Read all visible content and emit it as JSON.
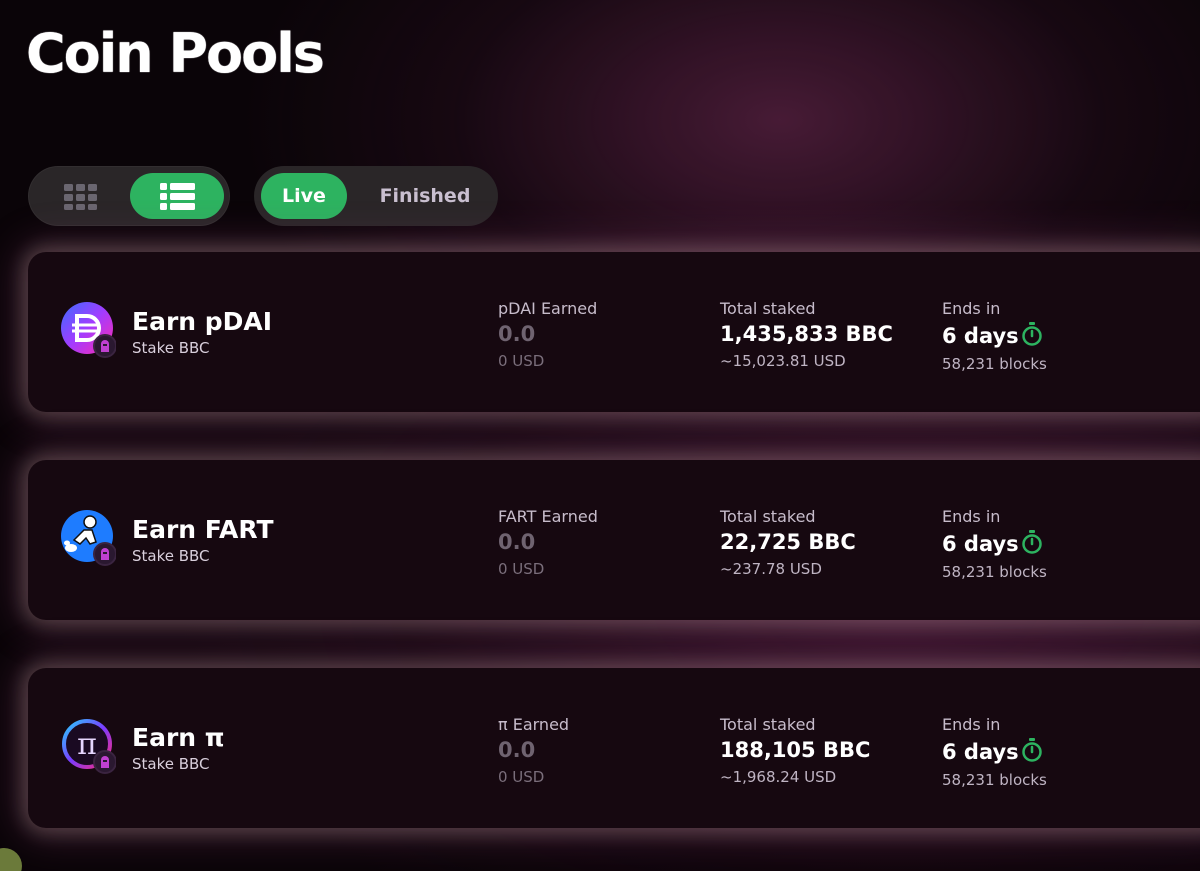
{
  "page": {
    "title": "Coin Pools"
  },
  "controls": {
    "view_icons": [
      "grid-view-icon",
      "list-view-icon"
    ],
    "active_view": "list",
    "status_tabs": [
      "Live",
      "Finished"
    ],
    "active_status": "Live"
  },
  "colors": {
    "accent": "#2db360",
    "card_bg": "#160810",
    "timer": "#2db360"
  },
  "pools": [
    {
      "title": "Earn pDAI",
      "subtitle": "Stake BBC",
      "icon": "pdai-token-icon",
      "earned_label": "pDAI Earned",
      "earned_value": "0.0",
      "earned_usd": "0 USD",
      "staked_label": "Total staked",
      "staked_value": "1,435,833 BBC",
      "staked_usd": "~15,023.81 USD",
      "ends_label": "Ends in",
      "ends_value": "6 days",
      "ends_blocks": "58,231 blocks"
    },
    {
      "title": "Earn FART",
      "subtitle": "Stake BBC",
      "icon": "fart-token-icon",
      "earned_label": "FART Earned",
      "earned_value": "0.0",
      "earned_usd": "0 USD",
      "staked_label": "Total staked",
      "staked_value": "22,725 BBC",
      "staked_usd": "~237.78 USD",
      "ends_label": "Ends in",
      "ends_value": "6 days",
      "ends_blocks": "58,231 blocks"
    },
    {
      "title": "Earn π",
      "subtitle": "Stake BBC",
      "icon": "pi-token-icon",
      "earned_label": "π Earned",
      "earned_value": "0.0",
      "earned_usd": "0 USD",
      "staked_label": "Total staked",
      "staked_value": "188,105 BBC",
      "staked_usd": "~1,968.24 USD",
      "ends_label": "Ends in",
      "ends_value": "6 days",
      "ends_blocks": "58,231 blocks"
    }
  ]
}
